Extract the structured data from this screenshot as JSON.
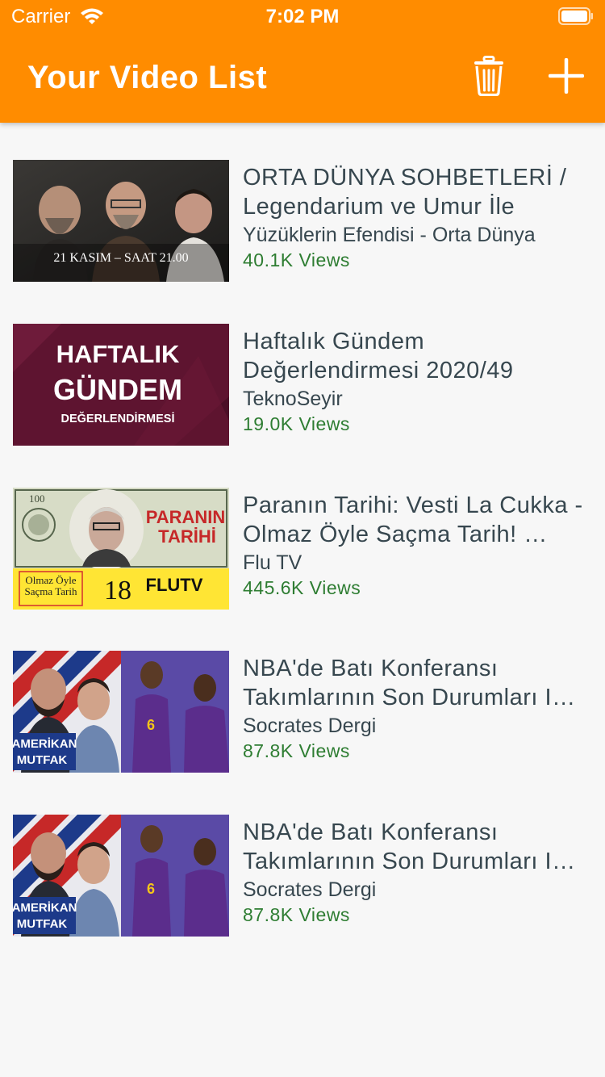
{
  "status_bar": {
    "carrier": "Carrier",
    "time": "7:02 PM"
  },
  "app_bar": {
    "title": "Your Video List",
    "background_color": "#ff8c00",
    "actions": [
      {
        "icon": "trash-icon"
      },
      {
        "icon": "plus-icon"
      }
    ]
  },
  "videos": [
    {
      "title": "ORTA DÜNYA SOHBETLERİ / Legendarium ve Umur İle",
      "channel": "Yüzüklerin Efendisi - Orta Dünya",
      "views": "40.1K Views",
      "thumbnail_text": "21 KASIM – SAAT 21.00"
    },
    {
      "title": "Haftalık Gündem Değerlendirmesi 2020/49",
      "channel": "TeknoSeyir",
      "views": "19.0K Views",
      "thumbnail_text": [
        "HAFTALIK",
        "GÜNDEM",
        "DEĞERLENDİRMESİ"
      ]
    },
    {
      "title": "Paranın Tarihi: Vesti La Cukka - Olmaz Öyle Saçma Tarih! …",
      "channel": "Flu TV",
      "views": "445.6K Views",
      "thumbnail_text": [
        "PARANIN",
        "TARİHİ",
        "Olmaz Öyle",
        "Saçma Tarih",
        "18",
        "FLUTV"
      ]
    },
    {
      "title": "NBA'de Batı Konferansı Takımlarının Son Durumları I…",
      "channel": "Socrates Dergi",
      "views": "87.8K Views",
      "thumbnail_text": [
        "AMERİKAN",
        "MUTFAK"
      ]
    },
    {
      "title": "NBA'de Batı Konferansı Takımlarının Son Durumları I…",
      "channel": "Socrates Dergi",
      "views": "87.8K Views",
      "thumbnail_text": [
        "AMERİKAN",
        "MUTFAK"
      ]
    }
  ],
  "colors": {
    "title_text": "#37474f",
    "views_text": "#2e7d32",
    "background": "#f7f7f7"
  }
}
